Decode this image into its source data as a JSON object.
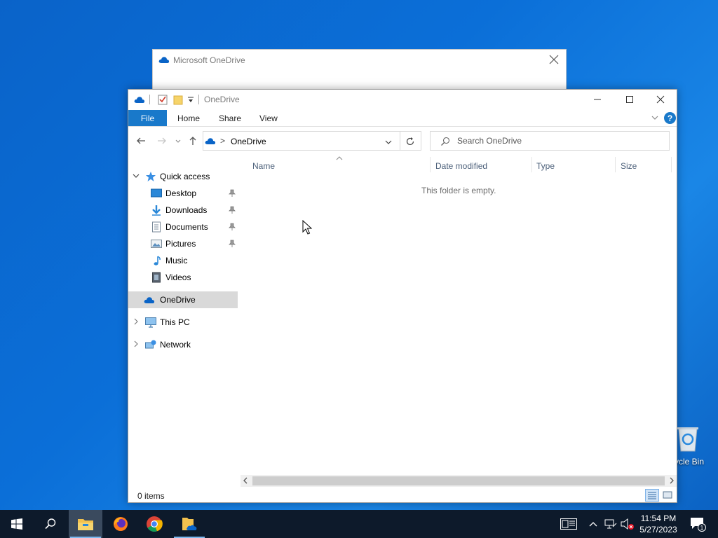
{
  "desktop": {
    "recycle_bin_label": "ycle Bin"
  },
  "onedrive_window": {
    "title": "Microsoft OneDrive"
  },
  "explorer": {
    "title": "OneDrive",
    "ribbon": {
      "file_tab": "File",
      "tabs": [
        "Home",
        "Share",
        "View"
      ],
      "help": "?"
    },
    "address": {
      "separator": ">",
      "location": "OneDrive"
    },
    "search": {
      "placeholder": "Search OneDrive"
    },
    "nav_pane": {
      "quick_access": "Quick access",
      "quick_items": [
        {
          "label": "Desktop",
          "icon": "desktop-icon",
          "pinned": true
        },
        {
          "label": "Downloads",
          "icon": "downloads-icon",
          "pinned": true
        },
        {
          "label": "Documents",
          "icon": "documents-icon",
          "pinned": true
        },
        {
          "label": "Pictures",
          "icon": "pictures-icon",
          "pinned": true
        },
        {
          "label": "Music",
          "icon": "music-icon",
          "pinned": false
        },
        {
          "label": "Videos",
          "icon": "videos-icon",
          "pinned": false
        }
      ],
      "onedrive": "OneDrive",
      "this_pc": "This PC",
      "network": "Network"
    },
    "columns": [
      "Name",
      "Date modified",
      "Type",
      "Size"
    ],
    "empty_message": "This folder is empty.",
    "status": {
      "item_count": "0 items"
    }
  },
  "taskbar": {
    "apps": [
      "start-icon",
      "search-icon",
      "file-explorer-icon",
      "firefox-icon",
      "chrome-icon",
      "onedrive-folder-icon"
    ],
    "clock": {
      "time": "11:54 PM",
      "date": "5/27/2023"
    },
    "notification_count": "1"
  },
  "colors": {
    "accent": "#1979ca",
    "taskbar": "#0d1a2b",
    "selected_nav": "#d9d9d9",
    "onedrive_blue": "#0a64c7"
  }
}
